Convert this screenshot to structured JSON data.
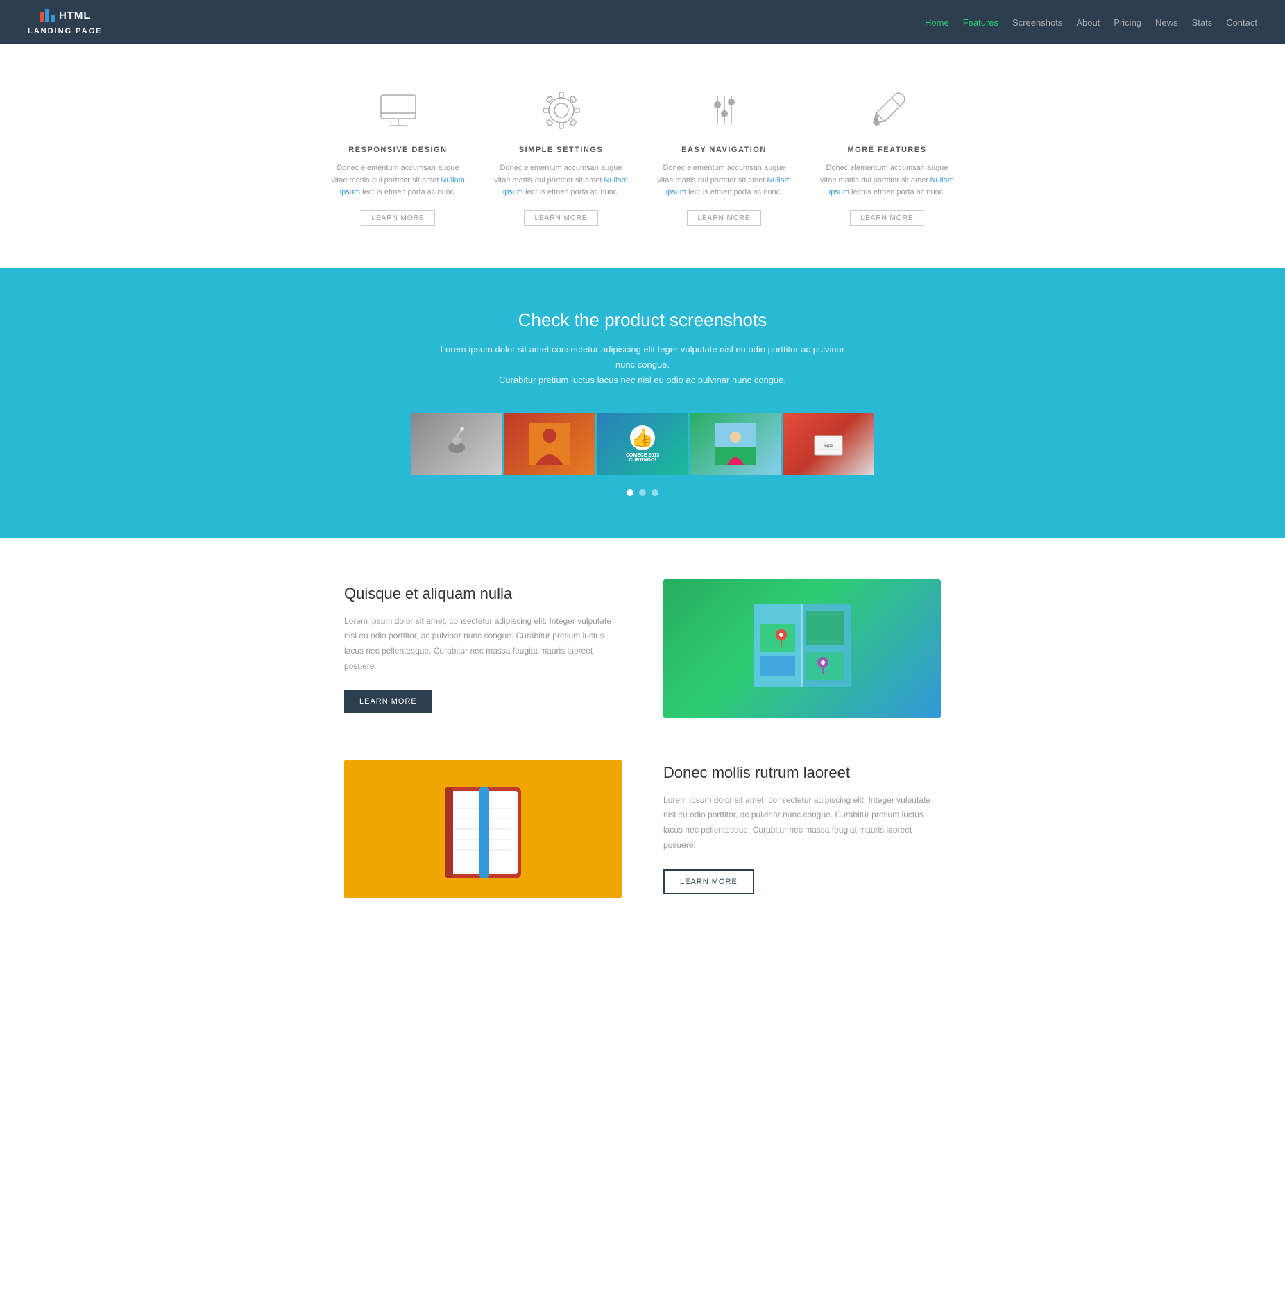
{
  "navbar": {
    "brand_name": "HTML",
    "brand_subtitle": "LANDING PAGE",
    "links": [
      {
        "label": "Home",
        "active": false
      },
      {
        "label": "Features",
        "active": true
      },
      {
        "label": "Screenshots",
        "active": false
      },
      {
        "label": "About",
        "active": false
      },
      {
        "label": "Pricing",
        "active": false
      },
      {
        "label": "News",
        "active": false
      },
      {
        "label": "Stats",
        "active": false
      },
      {
        "label": "Contact",
        "active": false
      }
    ]
  },
  "features": {
    "items": [
      {
        "icon": "monitor",
        "title": "RESPONSIVE DESIGN",
        "desc_main": "Donec elementum accumsan augue vitae mattis dui porttitor sit amet Nullam ipsum lectus etmen porta ac nunc.",
        "btn_label": "LEARN MORE"
      },
      {
        "icon": "gear",
        "title": "SIMPLE SETTINGS",
        "desc_main": "Donec elementum accumsan augue vitae mattis dui porttitor sit amet Nullam ipsum lectus etmen porta ac nunc.",
        "btn_label": "LEARN MORE"
      },
      {
        "icon": "sliders",
        "title": "EASY NAVIGATION",
        "desc_main": "Donec elementum accumsan augue vitae mattis dui porttitor sit amet Nullam ipsum lectus etmen porta ac nunc.",
        "btn_label": "LEARN MORE"
      },
      {
        "icon": "pencil",
        "title": "MORE FEATURES",
        "desc_main": "Donec elementum accumsan augue vitae mattis dui porttitor sit amet Nullam ipsum lectus etmen porta ac nunc.",
        "btn_label": "LEARN MORE"
      }
    ]
  },
  "screenshots": {
    "heading": "Check the product screenshots",
    "desc": "Lorem ipsum dolor sit amet consectetur adipiscing elit teger vulputate nisl eu odio porttitor ac pulvinar nunc congue.\nCurabitur pretium luctus lacus nec nisl eu odio ac pulvinar nunc congue.",
    "images": [
      {
        "label": "Screenshot 1"
      },
      {
        "label": "Screenshot 2"
      },
      {
        "label": "Screenshot 3"
      },
      {
        "label": "Screenshot 4"
      },
      {
        "label": "Screenshot 5"
      }
    ],
    "dots": [
      {
        "active": true
      },
      {
        "active": false
      },
      {
        "active": false
      }
    ]
  },
  "section_map": {
    "heading": "Quisque et aliquam nulla",
    "desc": "Lorem ipsum dolor sit amet, consectetur adipiscing elit. Integer vulputate nisl eu odio porttitor, ac pulvinar nunc congue. Curabitur pretium luctus lacus nec pellentesque. Curabitur nec massa feugiat mauris laoreet posuere.",
    "btn_label": "LEARN MORE"
  },
  "section_wallet": {
    "heading": "Donec mollis rutrum laoreet",
    "desc": "Lorem ipsum dolor sit amet, consectetur adipiscing elit. Integer vulputate nisl eu odio porttitor, ac pulvinar nunc congue. Curabitur pretium luctus lacus nec pellentesque. Curabitur nec massa feugiat mauris laoreet posuere.",
    "btn_label": "LEARN MORE"
  }
}
